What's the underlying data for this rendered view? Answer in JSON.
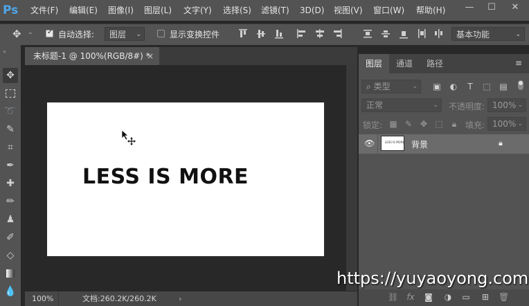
{
  "app": {
    "logo": "Ps"
  },
  "menu": [
    {
      "label": "文件(F)"
    },
    {
      "label": "编辑(E)"
    },
    {
      "label": "图像(I)"
    },
    {
      "label": "图层(L)"
    },
    {
      "label": "文字(Y)"
    },
    {
      "label": "选择(S)"
    },
    {
      "label": "滤镜(T)"
    },
    {
      "label": "3D(D)"
    },
    {
      "label": "视图(V)"
    },
    {
      "label": "窗口(W)"
    },
    {
      "label": "帮助(H)"
    }
  ],
  "window_controls": {
    "minimize": "—",
    "maximize": "☐",
    "close": "✕"
  },
  "options": {
    "auto_select_label": "自动选择:",
    "auto_select_checked": true,
    "auto_select_target": "图层",
    "show_transform_label": "显示变换控件",
    "show_transform_checked": false,
    "workspace": "基本功能"
  },
  "document": {
    "tab_title": "未标题-1 @ 100%(RGB/8#) *",
    "close_glyph": "×",
    "text": "LESS IS MORE",
    "zoom": "100%",
    "doc_size": "文档:260.2K/260.2K"
  },
  "panel": {
    "tabs": [
      {
        "label": "图层"
      },
      {
        "label": "通道"
      },
      {
        "label": "路径"
      }
    ],
    "filter_kind": "类型",
    "blend_mode": "正常",
    "opacity_label": "不透明度:",
    "opacity_value": "100%",
    "lock_label": "锁定:",
    "fill_label": "填充:",
    "fill_value": "100%",
    "layers": [
      {
        "name": "背景",
        "visible": true,
        "locked": true,
        "thumb_text": "LESS IS MORE"
      }
    ]
  },
  "watermark": "https://yuyaoyong.com",
  "colors": {
    "ui_bg": "#535353",
    "dark_bg": "#282828",
    "accent": "#4ea6e8",
    "canvas": "#ffffff"
  }
}
